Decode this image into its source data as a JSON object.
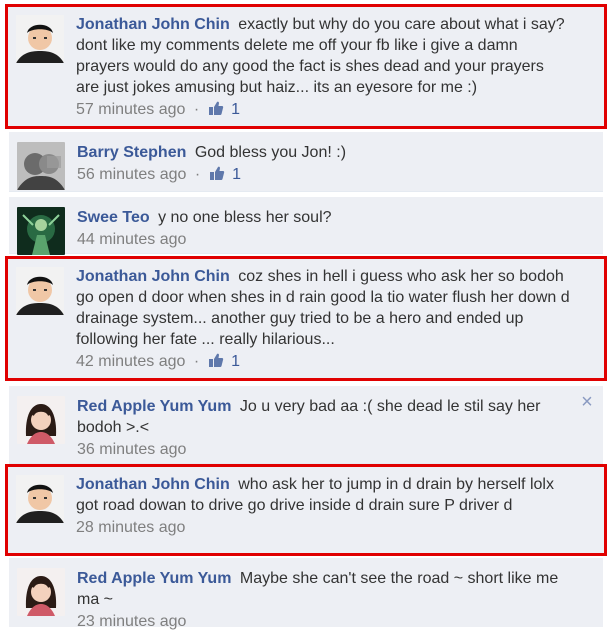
{
  "comments": [
    {
      "author": "Jonathan John Chin",
      "text": "exactly but why do you care about what i say? dont like my comments delete me off your fb like i give a damn prayers would do any good the fact is shes dead and your prayers are just jokes amusing but haiz... its an eyesore for me :)",
      "time": "57 minutes ago",
      "likes": "1",
      "highlighted": true
    },
    {
      "author": "Barry Stephen",
      "text": "God bless you Jon! :)",
      "time": "56 minutes ago",
      "likes": "1",
      "highlighted": false
    },
    {
      "author": "Swee Teo",
      "text": "y no one bless her soul?",
      "time": "44 minutes ago",
      "likes": "",
      "highlighted": false
    },
    {
      "author": "Jonathan John Chin",
      "text": "coz shes in hell i guess who ask her so bodoh go open d door when shes in d rain good la tio water flush her down d drainage system... another guy tried to be a hero and ended up following her fate ... really hilarious...",
      "time": "42 minutes ago",
      "likes": "1",
      "highlighted": true
    },
    {
      "author": "Red Apple Yum Yum",
      "text": "Jo u very bad aa :( she dead le stil say her bodoh >.<",
      "time": "36 minutes ago",
      "likes": "",
      "highlighted": false
    },
    {
      "author": "Jonathan John Chin",
      "text": "who ask her to jump in d drain by herself lolx got road dowan to drive go drive inside d drain sure P driver d",
      "time": "28 minutes ago",
      "likes": "",
      "highlighted": true
    },
    {
      "author": "Red Apple Yum Yum",
      "text": "Maybe she can't see the road ~ short like me ma ~",
      "time": "23 minutes ago",
      "likes": "",
      "highlighted": false
    }
  ],
  "close_glyph": "×",
  "meta_separator": "·",
  "colors": {
    "link": "#3b5998",
    "highlight_border": "#e00000",
    "comment_bg": "#edeff4"
  }
}
